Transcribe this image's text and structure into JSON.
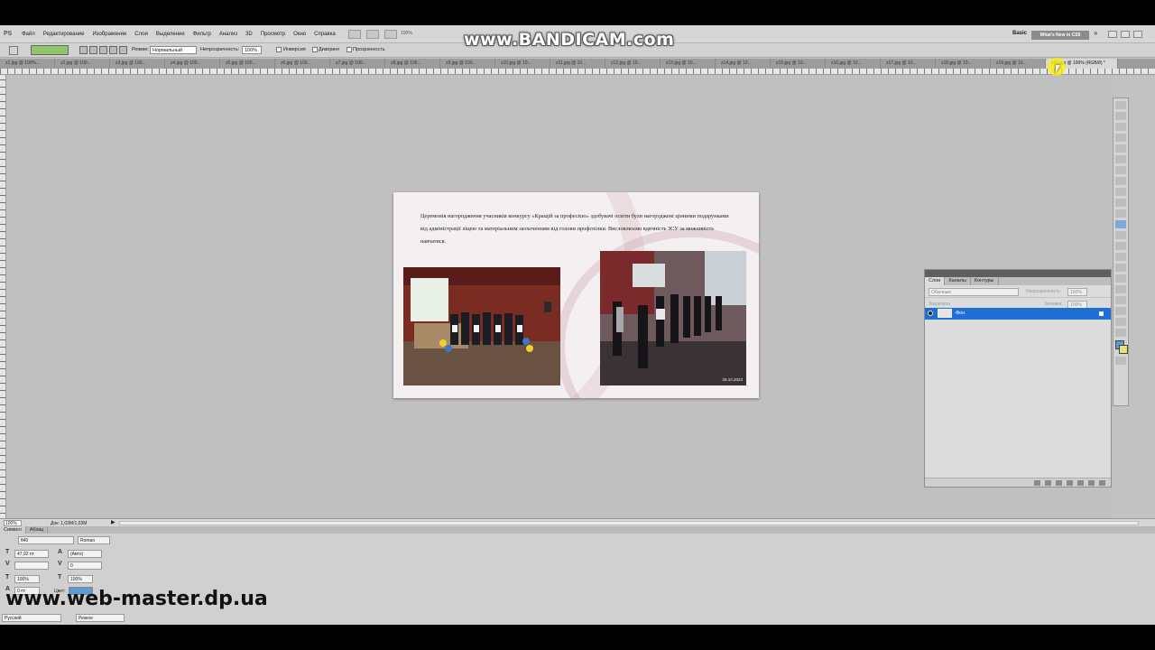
{
  "app": {
    "logo": "PS"
  },
  "menu": [
    "Файл",
    "Редактирование",
    "Изображение",
    "Слои",
    "Выделение",
    "Фильтр",
    "Анализ",
    "3D",
    "Просмотр",
    "Окно",
    "Справка"
  ],
  "menubar": {
    "zoom": "100%",
    "workspace": "Basic",
    "whats_new": "What's New in CS5"
  },
  "options": {
    "mode_label": "Режим:",
    "mode_value": "Нормальный",
    "opacity_label": "Непрозрачность:",
    "opacity_value": "100%",
    "reverse_label": "Инверсия",
    "dither_label": "Дизеринг",
    "transparency_label": "Прозрачность"
  },
  "tabs": [
    "z1.jpg @ 100%...",
    "z2.jpg @ 100...",
    "z3.jpg @ 100...",
    "z4.jpg @ 100...",
    "z5.jpg @ 100...",
    "z6.jpg @ 100...",
    "z7.jpg @ 100...",
    "z8.jpg @ 100...",
    "z9.jpg @ 100...",
    "z10.jpg @ 10...",
    "z11.jpg @ 10...",
    "z12.jpg @ 10...",
    "z13.jpg @ 10...",
    "z14.jpg @ 10...",
    "z15.jpg @ 10...",
    "z16.jpg @ 10...",
    "z17.jpg @ 10...",
    "z18.jpg @ 10...",
    "z19.jpg @ 10...",
    "z20.jpg @ 100% (RGB/8) *"
  ],
  "slide": {
    "caption": "Церемонія нагородження учасників конкурсу «Кращій за професією» здобувачі освіти  були нагороджені цінними подарунками від адміністрації ліцею та матеріальним заохоченням від голови профспілки. Висловлюємо вдячність ЗСУ за можливість навчатися.",
    "photo2_date": "26.10.2023"
  },
  "layers": {
    "tabs": [
      "Слои",
      "Каналы",
      "Контуры"
    ],
    "blend_mode": "Обычные",
    "opacity_label": "Непрозрачность:",
    "opacity_value": "100%",
    "lock_label": "Закрепить:",
    "fill_label": "Заливка:",
    "fill_value": "100%",
    "layer_name": "Фон"
  },
  "status": {
    "zoom": "100%",
    "doc": "Док: 1,03M/1,03M"
  },
  "character": {
    "tabs": [
      "Символ",
      "Абзац"
    ],
    "font": "ft40",
    "style": "Roman",
    "size": "47,92 пт",
    "leading": "(Авто)",
    "tracking": "0",
    "vscale": "100%",
    "hscale": "100%",
    "baseline": "0 пт",
    "color_label": "Цвет:",
    "language": "Русский",
    "antialias": "Резкое"
  },
  "watermarks": {
    "top": "www.BANDICAM.com",
    "bottom": "www.web-master.dp.ua"
  },
  "colors": {
    "foreground": "#5a9bd5",
    "background": "#e9e07a",
    "gradient": "#8fc66a",
    "selection": "#1f6ed6"
  }
}
